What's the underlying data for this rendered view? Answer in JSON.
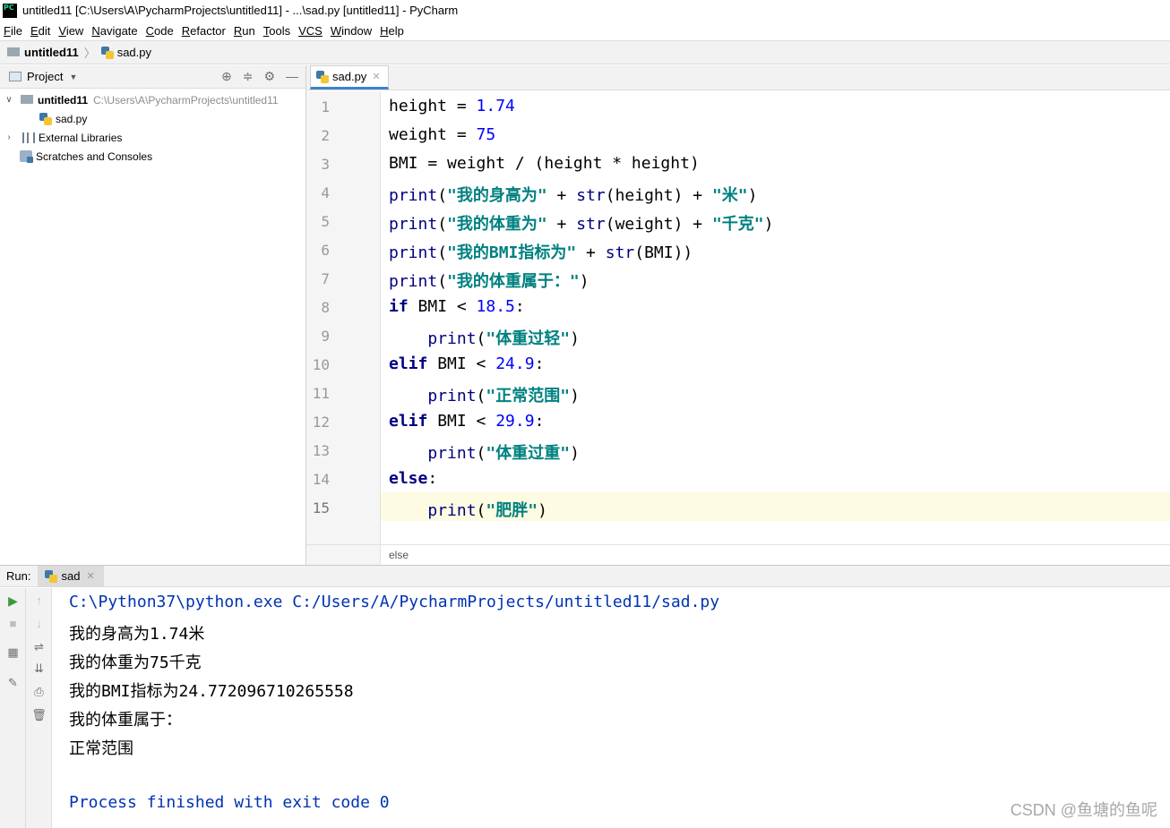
{
  "window": {
    "title": "untitled11 [C:\\Users\\A\\PycharmProjects\\untitled11] - ...\\sad.py [untitled11] - PyCharm",
    "icon_label": "PC"
  },
  "menu": [
    {
      "u": "F",
      "rest": "ile"
    },
    {
      "u": "E",
      "rest": "dit"
    },
    {
      "u": "V",
      "rest": "iew"
    },
    {
      "u": "N",
      "rest": "avigate"
    },
    {
      "u": "C",
      "rest": "ode"
    },
    {
      "u": "R",
      "rest": "efactor"
    },
    {
      "u": "R",
      "rest": "un",
      "pre": ""
    },
    {
      "u": "T",
      "rest": "ools"
    },
    {
      "u": "VCS",
      "rest": ""
    },
    {
      "u": "W",
      "rest": "indow"
    },
    {
      "u": "H",
      "rest": "elp"
    }
  ],
  "navbar": {
    "project": "untitled11",
    "file": "sad.py"
  },
  "project_panel": {
    "title": "Project",
    "tree": {
      "root_name": "untitled11",
      "root_path": "C:\\Users\\A\\PycharmProjects\\untitled11",
      "file": "sad.py",
      "external_libraries": "External Libraries",
      "scratches": "Scratches and Consoles"
    }
  },
  "editor": {
    "tab": "sad.py",
    "line_numbers": [
      "1",
      "2",
      "3",
      "4",
      "5",
      "6",
      "7",
      "8",
      "9",
      "10",
      "11",
      "12",
      "13",
      "14",
      "15"
    ],
    "breadcrumb": "else"
  },
  "run": {
    "label": "Run:",
    "tab": "sad",
    "output": [
      "C:\\Python37\\python.exe C:/Users/A/PycharmProjects/untitled11/sad.py",
      "我的身高为1.74米",
      "我的体重为75千克",
      "我的BMI指标为24.772096710265558",
      "我的体重属于：",
      "正常范围",
      "",
      "Process finished with exit code 0"
    ]
  },
  "watermark": "CSDN @鱼塘的鱼呢",
  "colors": {
    "keyword": "#000080",
    "string": "#008080",
    "number": "#0000ff",
    "console_path": "#0033b3",
    "current_line": "#fdfbe2",
    "tab_underline": "#4083c9"
  }
}
